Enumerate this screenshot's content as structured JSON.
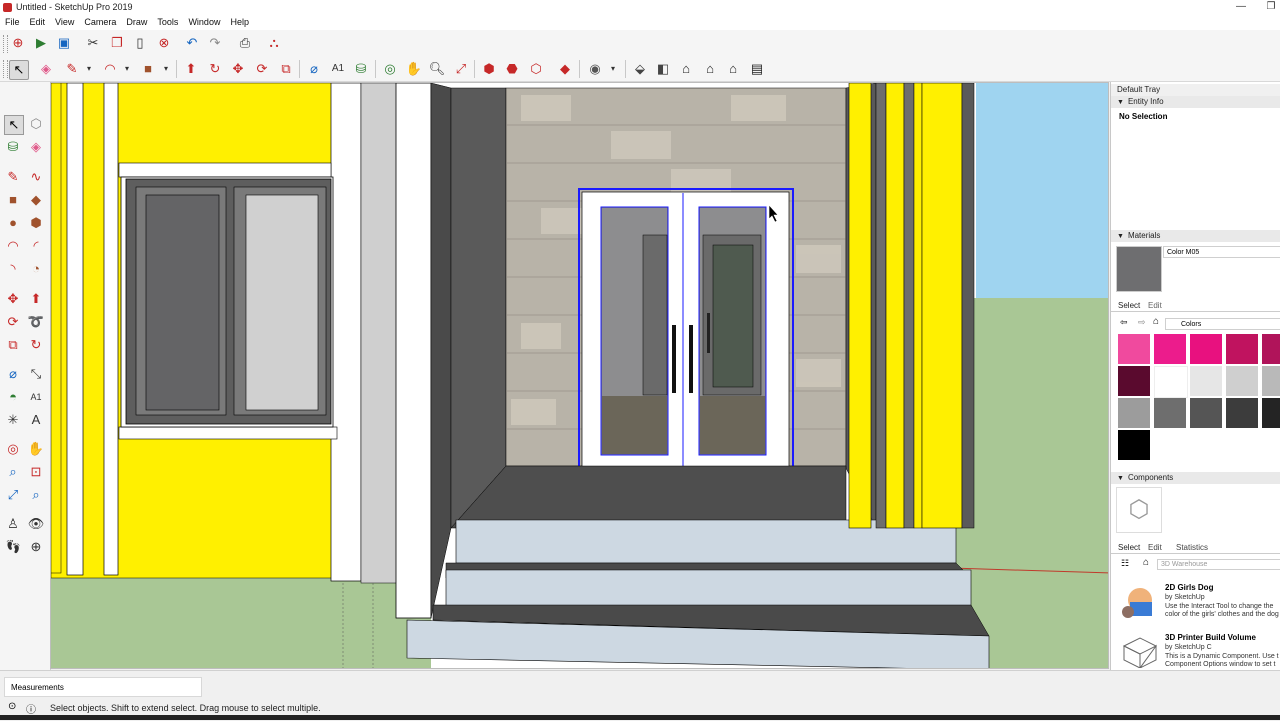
{
  "window": {
    "title": "Untitled - SketchUp Pro 2019",
    "minimize": "—",
    "restore": "❐"
  },
  "menu": [
    "File",
    "Edit",
    "View",
    "Camera",
    "Draw",
    "Tools",
    "Window",
    "Help"
  ],
  "tray": {
    "title": "Default Tray",
    "entity_info": {
      "header": "Entity Info",
      "selection": "No Selection"
    },
    "materials": {
      "header": "Materials",
      "current_name": "Color M05",
      "current_color": "#6e6e70",
      "tabs": [
        "Select",
        "Edit"
      ],
      "collection": "Colors",
      "swatches": [
        "#f04a9e",
        "#ec1c8c",
        "#e8117f",
        "#c0135f",
        "#b0145a",
        "#5a0a2e",
        "#ffffff",
        "#e6e6e6",
        "#cfcfcf",
        "#b9b9b9",
        "#9c9c9c",
        "#6e6e6e",
        "#555555",
        "#3c3c3c",
        "#242424",
        "#000000"
      ]
    },
    "components": {
      "header": "Components",
      "tabs": [
        "Select",
        "Edit",
        "Statistics"
      ],
      "search_placeholder": "3D Warehouse",
      "items": [
        {
          "title": "2D Girls Dog",
          "by": "by SketchUp",
          "desc1": "Use the Interact Tool to change the",
          "desc2": "color of the girls' clothes and the dog"
        },
        {
          "title": "3D Printer Build Volume",
          "by": "by SketchUp C",
          "desc1": "This is a Dynamic Component. Use t",
          "desc2": "Component Options window to set t"
        }
      ]
    }
  },
  "status": {
    "measurements_label": "Measurements",
    "hint": "Select objects. Shift to extend select. Drag mouse to select multiple."
  },
  "colors": {
    "yellow": "#fff000",
    "selection": "#1a1aff",
    "sky": "#a8d8f0",
    "ground": "#a9c795"
  }
}
